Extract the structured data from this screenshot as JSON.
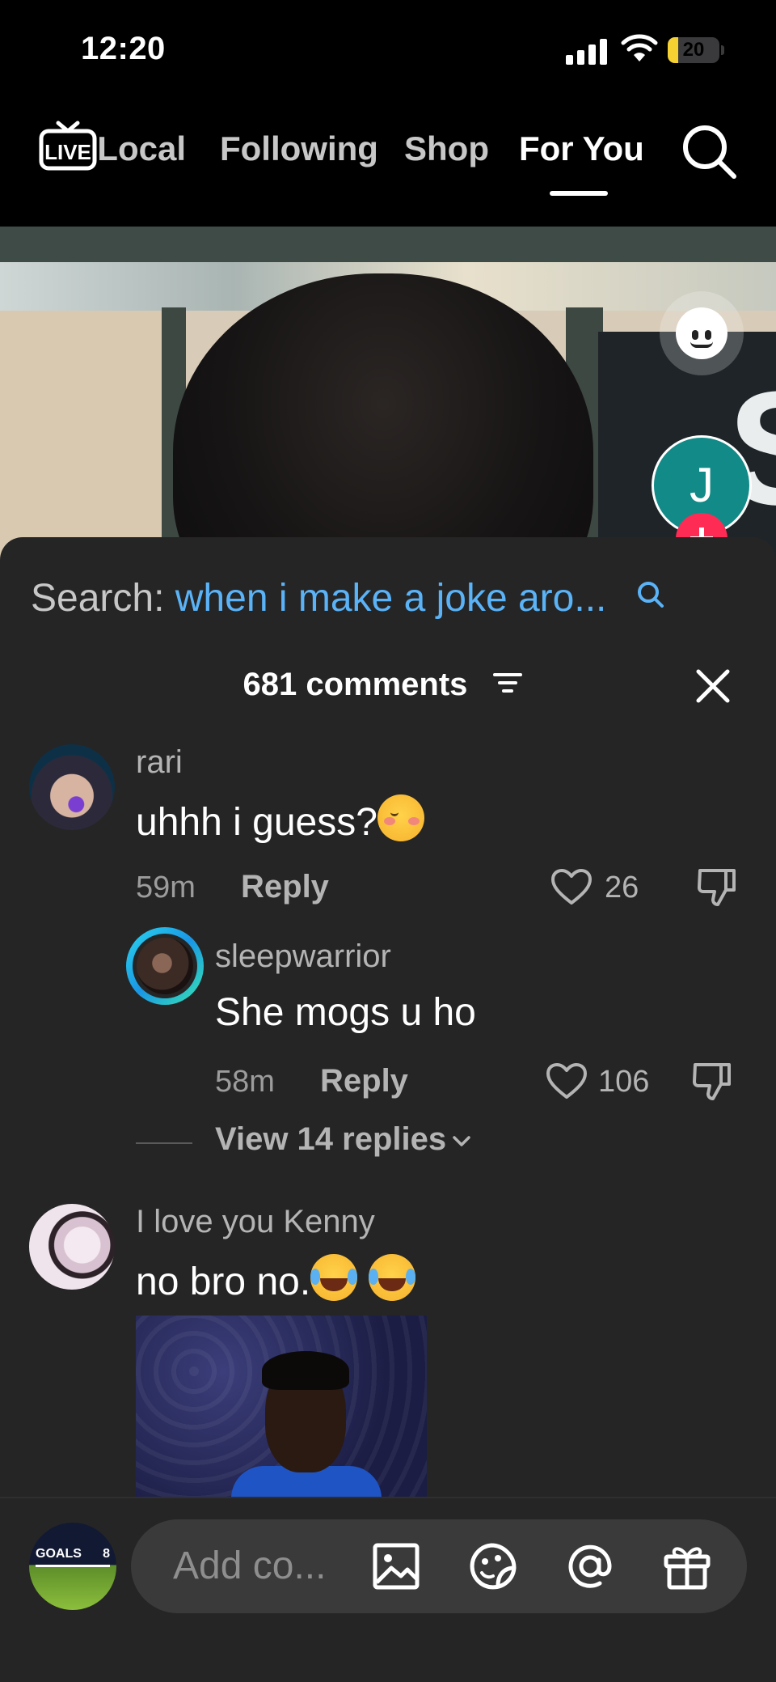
{
  "status_bar": {
    "time": "12:20",
    "battery": "20",
    "battery_level": 0.2
  },
  "top_nav": {
    "live_label": "LIVE",
    "tabs": [
      {
        "label": "Local",
        "shown": "ocal"
      },
      {
        "label": "Following"
      },
      {
        "label": "Shop"
      },
      {
        "label": "For You"
      }
    ],
    "active_tab": "For You"
  },
  "video": {
    "creator_initial": "J"
  },
  "comments": {
    "search_prefix": "Search: ",
    "search_query": "when i make a joke aro...",
    "count_label": "681 comments",
    "items": [
      {
        "author": "rari",
        "text": "uhhh i guess?",
        "emoji": "flushed-face",
        "time": "59m",
        "reply_label": "Reply",
        "likes": "26",
        "replies": [
          {
            "author": "sleepwarrior",
            "text": "She mogs u ho",
            "time": "58m",
            "reply_label": "Reply",
            "likes": "106"
          }
        ],
        "view_replies_label": "View 14 replies"
      },
      {
        "author": "I love you Kenny",
        "text": "no bro no.",
        "emoji": "face-with-tears-of-joy x2",
        "has_gif": true
      }
    ]
  },
  "bottom_bar": {
    "placeholder": "Add co...",
    "avatar_text": "GOALS",
    "avatar_num": "8"
  },
  "colors": {
    "accent_blue": "#5bb3f7",
    "follow_red": "#fe2c55",
    "sheet_bg": "#252525",
    "battery_yellow": "#f5d131"
  }
}
